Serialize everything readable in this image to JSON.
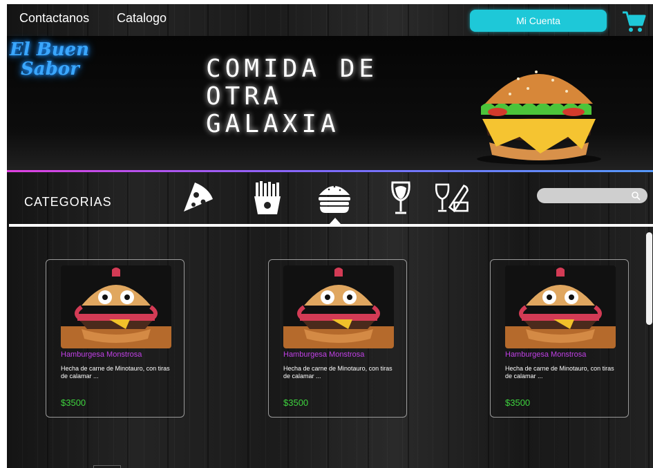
{
  "nav": {
    "links": [
      "Contactanos",
      "Catalogo"
    ],
    "account_label": "Mi Cuenta"
  },
  "banner": {
    "logo_line1": "El Buen",
    "logo_line2": "Sabor",
    "slogan_line1": "COMIDA DE",
    "slogan_line2": "OTRA",
    "slogan_line3": "GALAXIA"
  },
  "categories": {
    "label": "CATEGORIAS",
    "items": [
      {
        "icon": "pizza-icon"
      },
      {
        "icon": "fries-icon"
      },
      {
        "icon": "burger-icon",
        "selected": true
      },
      {
        "icon": "wine-glass-icon"
      },
      {
        "icon": "wine-bread-icon"
      }
    ],
    "search_placeholder": ""
  },
  "products": [
    {
      "name": "Hamburgesa Monstrosa",
      "description": "Hecha de carne de Minotauro, con tiras de calamar ...",
      "price": "$3500"
    },
    {
      "name": "Hamburgesa Monstrosa",
      "description": "Hecha de carne de Minotauro, con tiras de calamar ...",
      "price": "$3500"
    },
    {
      "name": "Hamburgesa Monstrosa",
      "description": "Hecha de carne de Minotauro, con tiras de calamar ...",
      "price": "$3500"
    }
  ],
  "colors": {
    "accent": "#1ec8d8",
    "product_title": "#c040e6",
    "price": "#3ed33e",
    "logo_neon": "#3aa7ff"
  }
}
